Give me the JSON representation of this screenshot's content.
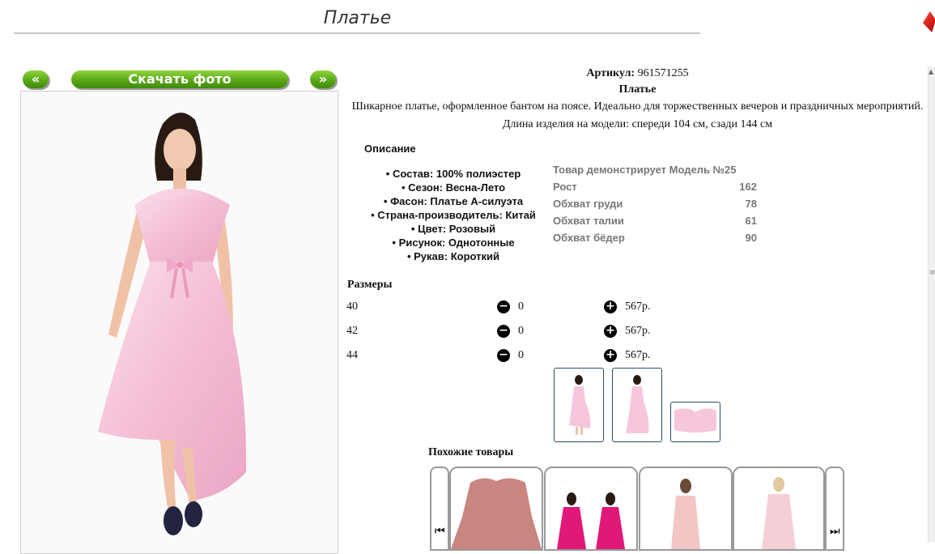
{
  "header": {
    "title": "Платье"
  },
  "gallery": {
    "prev_label": "«",
    "download_label": "Скачать фото",
    "next_label": "»"
  },
  "product": {
    "sku_label": "Артикул:",
    "sku_value": "961571255",
    "name": "Платье",
    "description": "Шикарное платье, оформленное бантом на поясе. Идеально для торжественных вечеров и праздничных мероприятий. Длина изделия на модели: спереди 104 см, сзади 144 см"
  },
  "description_section": {
    "heading": "Описание",
    "attributes": [
      "Состав: 100% полиэстер",
      "Сезон: Весна-Лето",
      "Фасон: Платье А-силуэта",
      "Страна-производитель: Китай",
      "Цвет: Розовый",
      "Рисунок: Однотонные",
      "Рукав: Короткий"
    ]
  },
  "model": {
    "title": "Товар демонстрирует Модель №25",
    "rows": [
      {
        "label": "Рост",
        "value": "162"
      },
      {
        "label": "Обхват груди",
        "value": "78"
      },
      {
        "label": "Обхват талии",
        "value": "61"
      },
      {
        "label": "Обхват бёдер",
        "value": "90"
      }
    ]
  },
  "sizes": {
    "heading": "Размеры",
    "rows": [
      {
        "size": "40",
        "qty": "0",
        "price": "567р."
      },
      {
        "size": "42",
        "qty": "0",
        "price": "567р."
      },
      {
        "size": "44",
        "qty": "0",
        "price": "567р."
      }
    ]
  },
  "similar": {
    "heading": "Похожие товары"
  },
  "icons": {
    "minus": "minus-circle-icon",
    "plus": "plus-circle-icon",
    "carousel_prev": "skip-back-icon",
    "carousel_next": "skip-forward-icon"
  },
  "colors": {
    "button_green": "#5aa818",
    "dress_pink": "#f6c6dc",
    "thumb_border": "#2d4a6b"
  }
}
